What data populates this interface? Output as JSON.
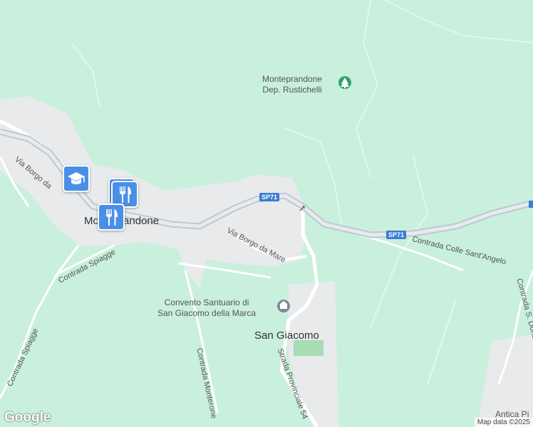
{
  "map": {
    "places": {
      "town": "Monteprandone",
      "village": "San Giacomo",
      "park_line1": "Monteprandone",
      "park_line2": "Dep. Rustichelli",
      "convent_line1": "Convento Santuario di",
      "convent_line2": "San Giacomo della Marca",
      "antica": "Antica Pi"
    },
    "roads": {
      "via_borgo_upper": "Via Borgo da",
      "via_borgo_lower": "Via Borgo da Mare",
      "contrada_spiagge_upper": "Contrada Spiagge",
      "contrada_spiagge_lower": "Contrada Spiagge",
      "contrada_monterone": "Contrada Monterone",
      "strada_provinciale": "Strada Provinciale 54",
      "contrada_colle": "Contrada Colle Sant'Angelo",
      "contrada_donato": "Contrada S. Donato",
      "shield_sp71_a": "SP71",
      "shield_sp71_b": "SP71"
    },
    "markers": [
      {
        "type": "school",
        "icon": "graduation-cap-icon"
      },
      {
        "type": "restaurant",
        "icon": "fork-knife-icon"
      },
      {
        "type": "restaurant",
        "icon": "fork-knife-icon"
      },
      {
        "type": "restaurant",
        "icon": "fork-knife-icon"
      }
    ],
    "colors": {
      "land": "#c9f0dc",
      "urban": "#e8eaec",
      "road": "#ffffff",
      "highway": "#bfc7d0",
      "marker": "#4a8fe7"
    }
  },
  "footer": {
    "logo": "Google",
    "attribution": "Map data ©2025"
  }
}
